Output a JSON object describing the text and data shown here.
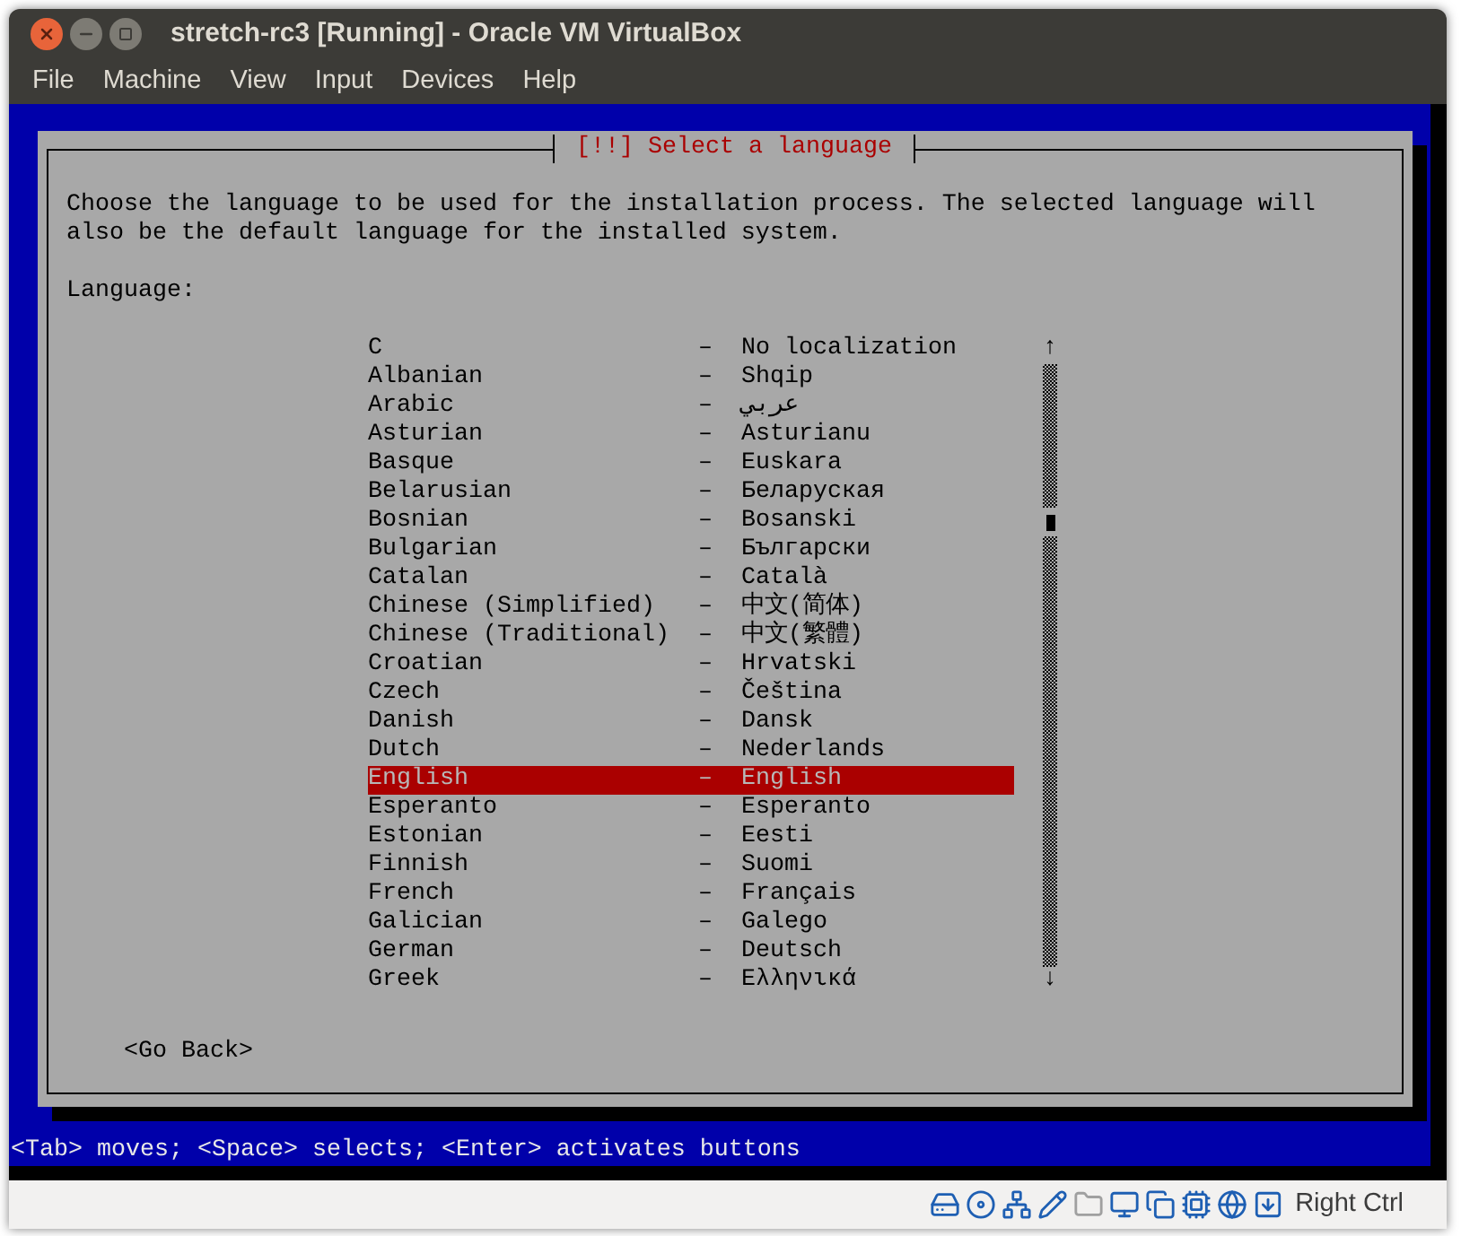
{
  "window": {
    "title": "stretch-rc3 [Running] - Oracle VM VirtualBox"
  },
  "menu": [
    "File",
    "Machine",
    "View",
    "Input",
    "Devices",
    "Help"
  ],
  "dialog": {
    "title": "[!!] Select a language",
    "prompt": "Choose the language to be used for the installation process. The selected language will also be the default language for the installed system.",
    "label": "Language:",
    "languages": [
      {
        "name": "C",
        "dash": "–",
        "native": "No localization",
        "selected": false
      },
      {
        "name": "Albanian",
        "dash": "–",
        "native": "Shqip",
        "selected": false
      },
      {
        "name": "Arabic",
        "dash": "–",
        "native": "عربي",
        "selected": false
      },
      {
        "name": "Asturian",
        "dash": "–",
        "native": "Asturianu",
        "selected": false
      },
      {
        "name": "Basque",
        "dash": "–",
        "native": "Euskara",
        "selected": false
      },
      {
        "name": "Belarusian",
        "dash": "–",
        "native": "Беларуская",
        "selected": false
      },
      {
        "name": "Bosnian",
        "dash": "–",
        "native": "Bosanski",
        "selected": false
      },
      {
        "name": "Bulgarian",
        "dash": "–",
        "native": "Български",
        "selected": false
      },
      {
        "name": "Catalan",
        "dash": "–",
        "native": "Català",
        "selected": false
      },
      {
        "name": "Chinese (Simplified)",
        "dash": "–",
        "native": "中文(简体)",
        "selected": false
      },
      {
        "name": "Chinese (Traditional)",
        "dash": "–",
        "native": "中文(繁體)",
        "selected": false
      },
      {
        "name": "Croatian",
        "dash": "–",
        "native": "Hrvatski",
        "selected": false
      },
      {
        "name": "Czech",
        "dash": "–",
        "native": "Čeština",
        "selected": false
      },
      {
        "name": "Danish",
        "dash": "–",
        "native": "Dansk",
        "selected": false
      },
      {
        "name": "Dutch",
        "dash": "–",
        "native": "Nederlands",
        "selected": false
      },
      {
        "name": "English",
        "dash": "–",
        "native": "English",
        "selected": true
      },
      {
        "name": "Esperanto",
        "dash": "–",
        "native": "Esperanto",
        "selected": false
      },
      {
        "name": "Estonian",
        "dash": "–",
        "native": "Eesti",
        "selected": false
      },
      {
        "name": "Finnish",
        "dash": "–",
        "native": "Suomi",
        "selected": false
      },
      {
        "name": "French",
        "dash": "–",
        "native": "Français",
        "selected": false
      },
      {
        "name": "Galician",
        "dash": "–",
        "native": "Galego",
        "selected": false
      },
      {
        "name": "German",
        "dash": "–",
        "native": "Deutsch",
        "selected": false
      },
      {
        "name": "Greek",
        "dash": "–",
        "native": "Ελληνικά",
        "selected": false
      }
    ],
    "scroll_up": "↑",
    "scroll_down": "↓",
    "back_button": "<Go Back>"
  },
  "hint": "<Tab> moves; <Space> selects; <Enter> activates buttons",
  "status_bar": {
    "host_key": "Right Ctrl"
  }
}
